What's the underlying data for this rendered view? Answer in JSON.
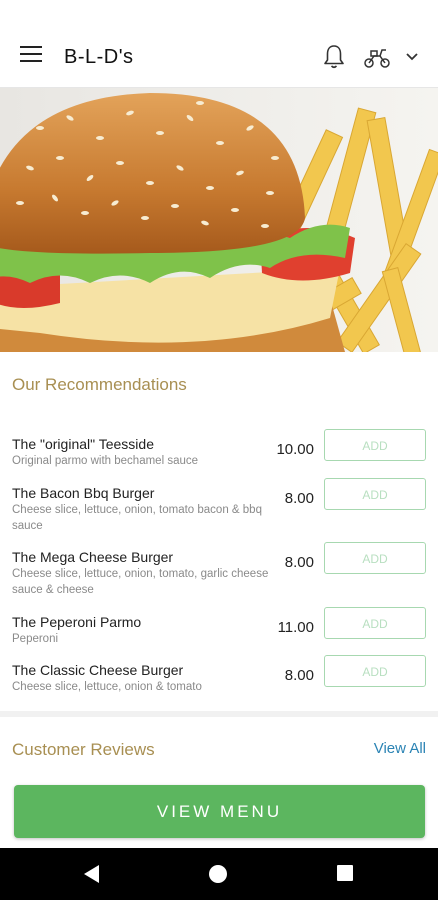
{
  "app_bar": {
    "title": "B-L-D's",
    "menu_icon": "hamburger-menu-icon",
    "notification_icon": "bell-icon",
    "delivery_icon": "scooter-icon",
    "dropdown_icon": "chevron-down-icon"
  },
  "hero": {
    "image": "burger-and-fries-photo"
  },
  "recommendations": {
    "title": "Our Recommendations",
    "add_label": "ADD",
    "items": [
      {
        "name": "The \"original\" Teesside",
        "description": "Original parmo with bechamel sauce",
        "price": "10.00"
      },
      {
        "name": "The Bacon Bbq Burger",
        "description": "Cheese slice, lettuce, onion, tomato bacon & bbq sauce",
        "price": "8.00"
      },
      {
        "name": "The Mega Cheese Burger",
        "description": "Cheese slice, lettuce, onion, tomato, garlic cheese sauce & cheese",
        "price": "8.00"
      },
      {
        "name": "The Peperoni Parmo",
        "description": "Peperoni",
        "price": "11.00"
      },
      {
        "name": "The Classic Cheese Burger",
        "description": "Cheese slice, lettuce, onion & tomato",
        "price": "8.00"
      }
    ]
  },
  "reviews": {
    "title": "Customer Reviews",
    "view_all": "View All"
  },
  "cta": {
    "label": "VIEW MENU"
  },
  "system_nav": {
    "back_icon": "back-triangle-icon",
    "home_icon": "home-circle-icon",
    "recents_icon": "recents-square-icon"
  },
  "colors": {
    "accent_gold": "#a88f52",
    "primary_green": "#5cb65f",
    "link_blue": "#2a83b4",
    "add_border": "#a7d8b0"
  }
}
